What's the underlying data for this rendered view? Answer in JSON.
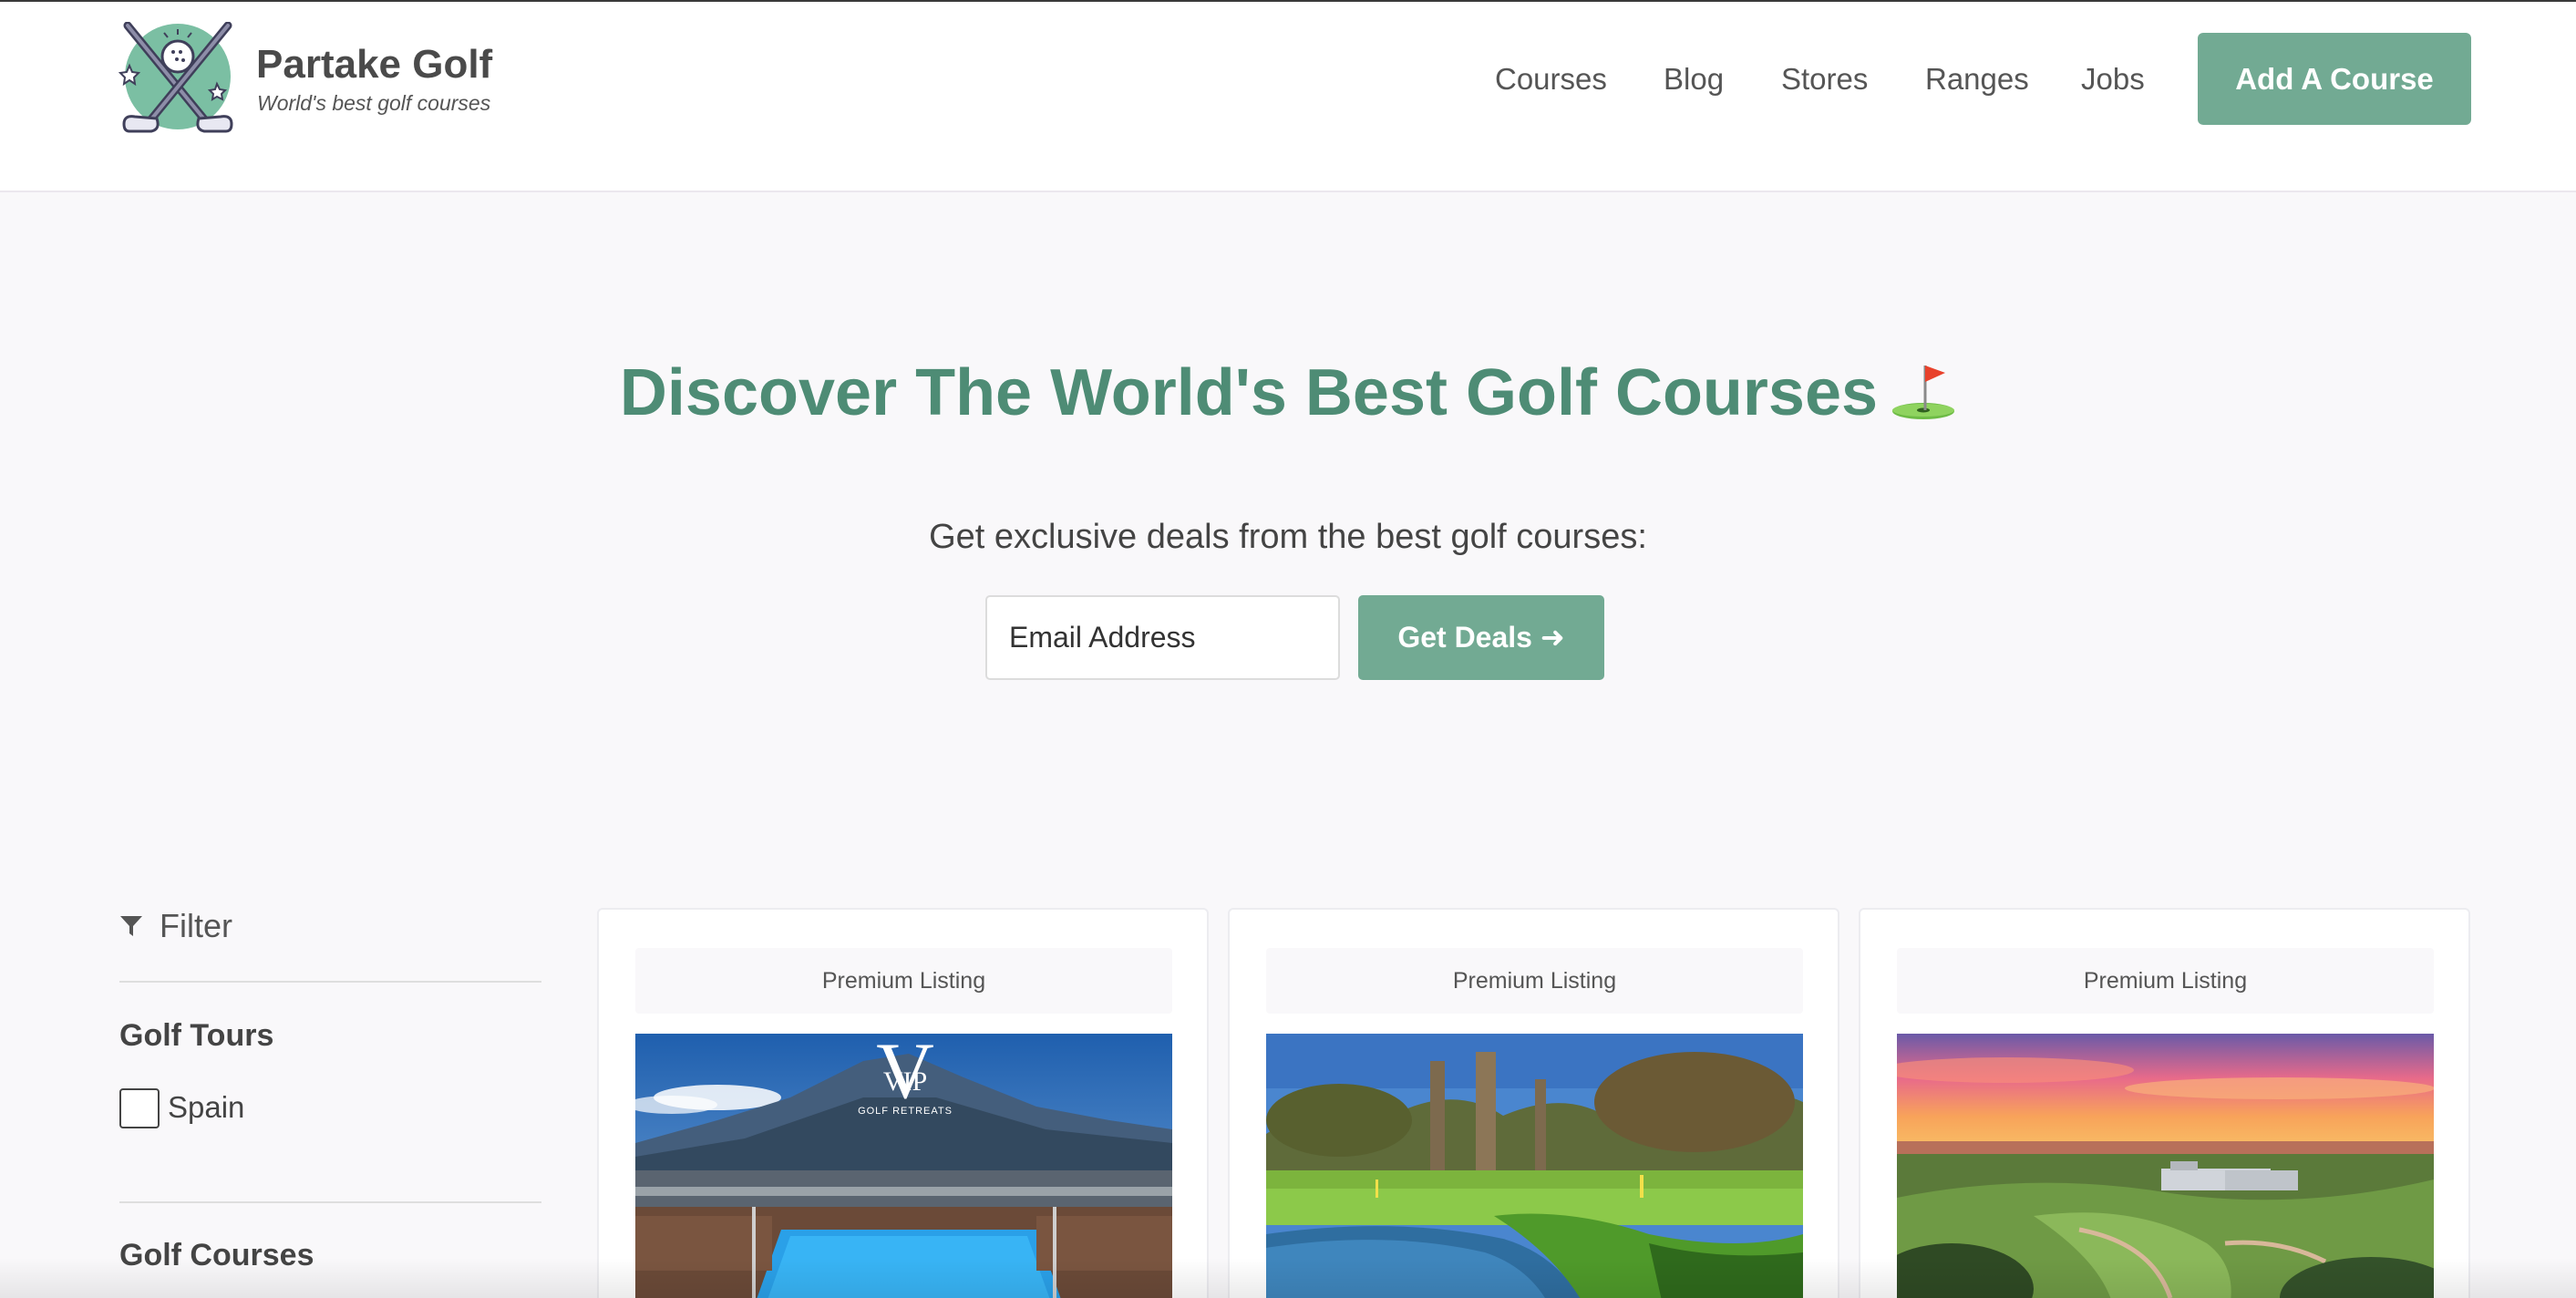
{
  "brand": {
    "name": "Partake Golf",
    "tagline": "World's best golf courses"
  },
  "nav": {
    "links": [
      "Courses",
      "Blog",
      "Stores",
      "Ranges",
      "Jobs"
    ],
    "cta_label": "Add A Course"
  },
  "hero": {
    "title": "Discover The World's Best Golf Courses",
    "title_icon": "golf-flag-icon",
    "subtitle": "Get exclusive deals from the best golf courses:",
    "email_placeholder": "Email Address",
    "deals_button_label": "Get Deals ➜"
  },
  "filter": {
    "label": "Filter",
    "icon": "funnel-icon",
    "sections": [
      {
        "title": "Golf Tours",
        "options": [
          "Spain"
        ]
      },
      {
        "title": "Golf Courses",
        "options": []
      }
    ]
  },
  "listings": [
    {
      "badge": "Premium Listing",
      "image": "vip-golf-retreats-pool-mountain",
      "image_text": {
        "monogram": "V",
        "overlay": "VIP",
        "caption": "GOLF RETREATS"
      }
    },
    {
      "badge": "Premium Listing",
      "image": "golf-course-stream-trees"
    },
    {
      "badge": "Premium Listing",
      "image": "golf-resort-sunset-aerial"
    }
  ],
  "colors": {
    "accent": "#72aa93",
    "title_green": "#4e8c75",
    "background": "#f9f8fa"
  }
}
